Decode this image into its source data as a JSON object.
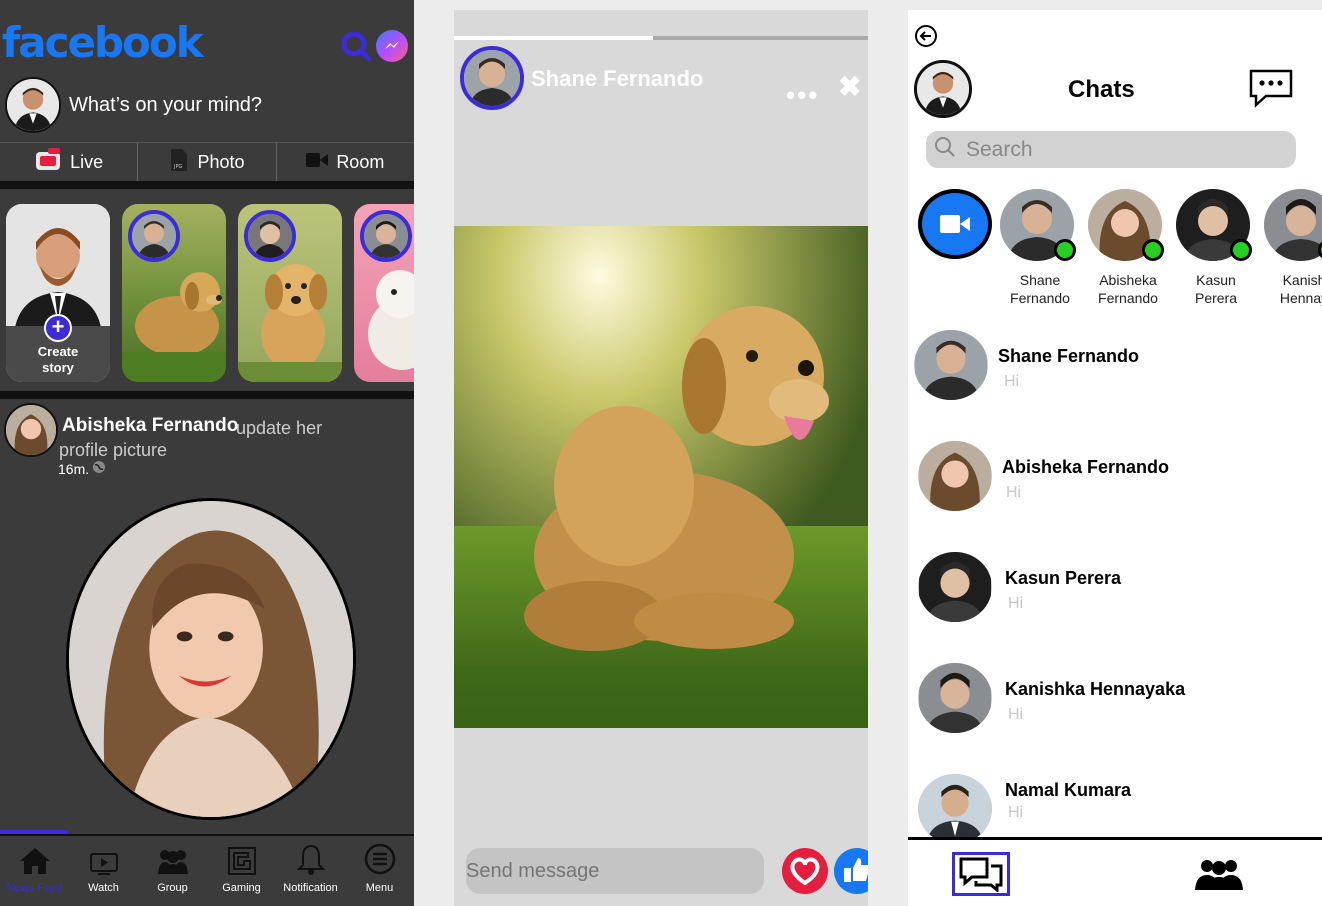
{
  "feed": {
    "logo": "facebook",
    "composer_placeholder": "What’s on your mind?",
    "actions": [
      {
        "label": "Live",
        "icon": "live-video-icon"
      },
      {
        "label": "Photo",
        "icon": "photo-file-icon"
      },
      {
        "label": "Room",
        "icon": "video-camera-icon"
      }
    ],
    "create_story": {
      "line1": "Create",
      "line2": "story"
    },
    "post": {
      "author": "Abisheka Fernando",
      "action_line1": "update her",
      "action_line2": "profile picture",
      "time": "16m."
    },
    "nav": [
      {
        "label": "News Feed",
        "icon": "home-icon",
        "active": true
      },
      {
        "label": "Watch",
        "icon": "watch-tv-icon"
      },
      {
        "label": "Group",
        "icon": "group-icon"
      },
      {
        "label": "Gaming",
        "icon": "gaming-icon"
      },
      {
        "label": "Notification",
        "icon": "bell-icon"
      },
      {
        "label": "Menu",
        "icon": "menu-icon"
      }
    ]
  },
  "story_viewer": {
    "author": "Shane Fernando",
    "more": "•••",
    "close": "✖",
    "progress": 0.48,
    "message_placeholder": "Send message"
  },
  "chats": {
    "title": "Chats",
    "search_placeholder": "Search",
    "active": [
      {
        "line1": "Shane",
        "line2": "Fernando"
      },
      {
        "line1": "Abisheka",
        "line2": "Fernando"
      },
      {
        "line1": "Kasun",
        "line2": "Perera"
      },
      {
        "line1": "Kanish",
        "line2": "Hennay"
      }
    ],
    "list": [
      {
        "name": "Shane Fernando",
        "message": "Hi"
      },
      {
        "name": "Abisheka Fernando",
        "message": "Hi"
      },
      {
        "name": "Kasun Perera",
        "message": "Hi"
      },
      {
        "name": "Kanishka Hennayaka",
        "message": "Hi"
      },
      {
        "name": "Namal Kumara",
        "message": "Hi"
      }
    ]
  },
  "colors": {
    "brand": "#1877f2",
    "accent": "#3b2bd9",
    "online": "#25d022",
    "heart": "#e41e3f"
  }
}
